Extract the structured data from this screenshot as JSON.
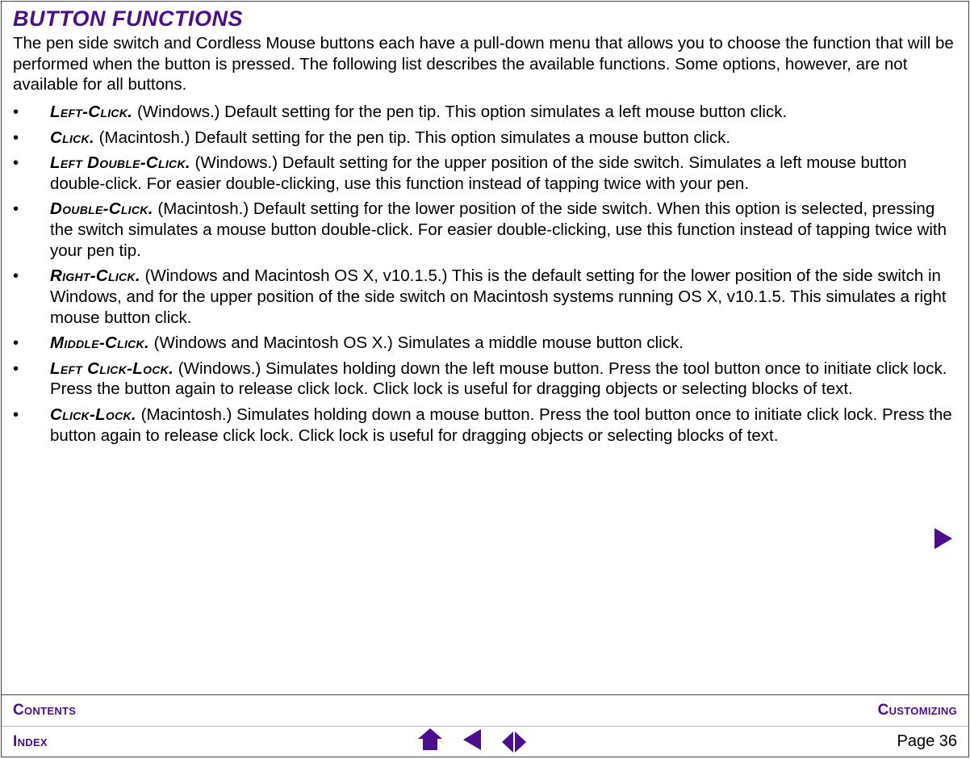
{
  "header": {
    "title": "BUTTON FUNCTIONS"
  },
  "intro": "The pen side switch and Cordless Mouse buttons each have a pull-down menu that allows you to choose the function that will be performed when the button is pressed.  The following list describes the available functions.  Some options, however, are not available for all buttons.",
  "items": [
    {
      "term": "Left-Click.",
      "desc": "  (Windows.)  Default setting for the pen tip.  This option simulates a left mouse button click."
    },
    {
      "term": "Click.",
      "desc": "  (Macintosh.)  Default setting for the pen tip.  This option simulates a mouse button click."
    },
    {
      "term": "Left Double-Click.",
      "desc": "  (Windows.)  Default setting for the upper position of the side switch.  Simulates a left mouse button double-click.  For easier double-clicking, use this function instead of tapping twice with your pen."
    },
    {
      "term": "Double-Click.",
      "desc": "  (Macintosh.)  Default setting for the lower position of the side switch.  When this option is selected, pressing the switch simulates a mouse button double-click.  For easier double-clicking, use this function instead of tapping twice with your pen tip."
    },
    {
      "term": "Right-Click.",
      "desc": "  (Windows and Macintosh OS X, v10.1.5.)  This is the default setting for the lower position of the side switch in Windows, and for the upper position of the side switch on Macintosh systems running OS X, v10.1.5.  This simulates a right mouse button click."
    },
    {
      "term": "Middle-Click.",
      "desc": "  (Windows and Macintosh OS X.)  Simulates a middle mouse button click."
    },
    {
      "term": "Left Click-Lock.",
      "desc": "  (Windows.)  Simulates holding down the left mouse button.  Press the tool button once to initiate click lock.  Press the button again to release click lock.  Click lock is useful for dragging objects or selecting blocks of text."
    },
    {
      "term": "Click-Lock.",
      "desc": "  (Macintosh.)  Simulates holding down a mouse button.  Press the tool button once to initiate click lock.  Press the button again to release click lock.  Click lock is useful for dragging objects or selecting blocks of text."
    }
  ],
  "footer": {
    "contents": "Contents",
    "customizing": "Customizing",
    "index": "Index",
    "page_label": "Page  36"
  }
}
